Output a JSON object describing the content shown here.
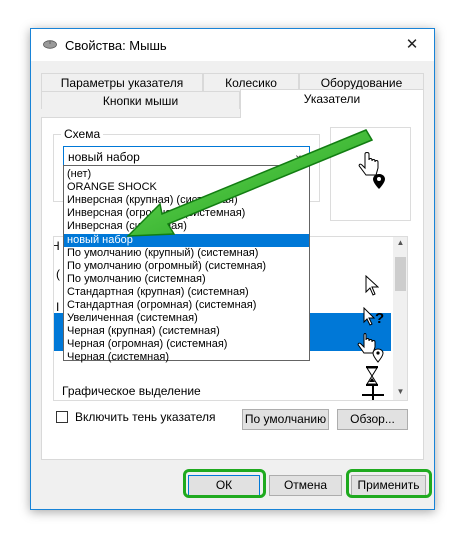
{
  "window": {
    "title": "Свойства: Мышь",
    "close_glyph": "✕"
  },
  "tabs": {
    "row_back": [
      "Параметры указателя",
      "Колесико",
      "Оборудование"
    ],
    "row_front": [
      "Кнопки мыши",
      "Указатели"
    ],
    "active": "Указатели"
  },
  "scheme": {
    "legend": "Схема",
    "selected_value": "новый набор",
    "arrow_glyph": "⌄",
    "options": [
      "(нет)",
      "ORANGE SHOCK",
      "Инверсная (крупная) (системная)",
      "Инверсная (огромная) (системная)",
      "Инверсная (системная)",
      "новый набор",
      "По умолчанию (крупный) (системная)",
      "По умолчанию (огромный) (системная)",
      "По умолчанию (системная)",
      "Стандартная (крупная) (системная)",
      "Стандартная (огромная) (системная)",
      "Увеличенная (системная)",
      "Черная (крупная) (системная)",
      "Черная (огромная) (системная)",
      "Черная (системная)"
    ],
    "highlighted_index": 5
  },
  "cursor_list": {
    "partial_label_header": "Н",
    "partial_label_row1": "(",
    "partial_label_row2": "I",
    "last_row_label": "Графическое выделение",
    "icons": [
      "arrow-cursor-icon",
      "help-cursor-icon",
      "hand-location-cursor-icon",
      "hourglass-cursor-icon",
      "crosshair-cursor-icon"
    ]
  },
  "options": {
    "shadow_label": "Включить тень указателя",
    "shadow_checked": false
  },
  "buttons": {
    "default": "По умолчанию",
    "browse": "Обзор...",
    "ok": "ОК",
    "cancel": "Отмена",
    "apply": "Применить"
  },
  "colors": {
    "accent": "#0078d7",
    "highlight_green": "#1faa1f"
  }
}
